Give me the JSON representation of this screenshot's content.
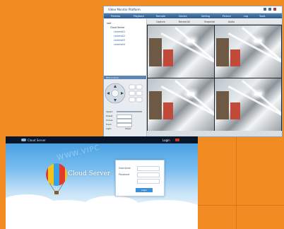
{
  "colors": {
    "desktop": "#f28c22",
    "accent": "#2d5a8b",
    "login_button": "#3f8fd6"
  },
  "vms": {
    "title": "Video Monitor Platform",
    "menu": [
      "Preview",
      "Playback",
      "Remote",
      "Device",
      "Setting",
      "Picture",
      "Log",
      "Tools"
    ],
    "toolbar": [
      "Capture",
      "Record All",
      "Snapshot",
      "Audio"
    ],
    "tree": [
      "root",
      "Cloud Server",
      "camera01",
      "camera02",
      "camera03",
      "camera04"
    ],
    "ptz_header": "PTZ Control",
    "ptz_labels": [
      "Speed",
      "Preset",
      "Cruise",
      "Track",
      "Light",
      "Wiper"
    ],
    "icons": [
      "close-icon",
      "up-arrow-icon",
      "down-arrow-icon",
      "left-arrow-icon",
      "right-arrow-icon",
      "zoom-icon",
      "focus-icon",
      "iris-icon"
    ]
  },
  "login": {
    "logo": "Cloud Server",
    "watermark": "WWW.VIPC",
    "balloon_caption": "Cloud Server",
    "username_label": "Username",
    "password_label": "Password",
    "login_button": "Login",
    "top_right_link": "Login"
  }
}
